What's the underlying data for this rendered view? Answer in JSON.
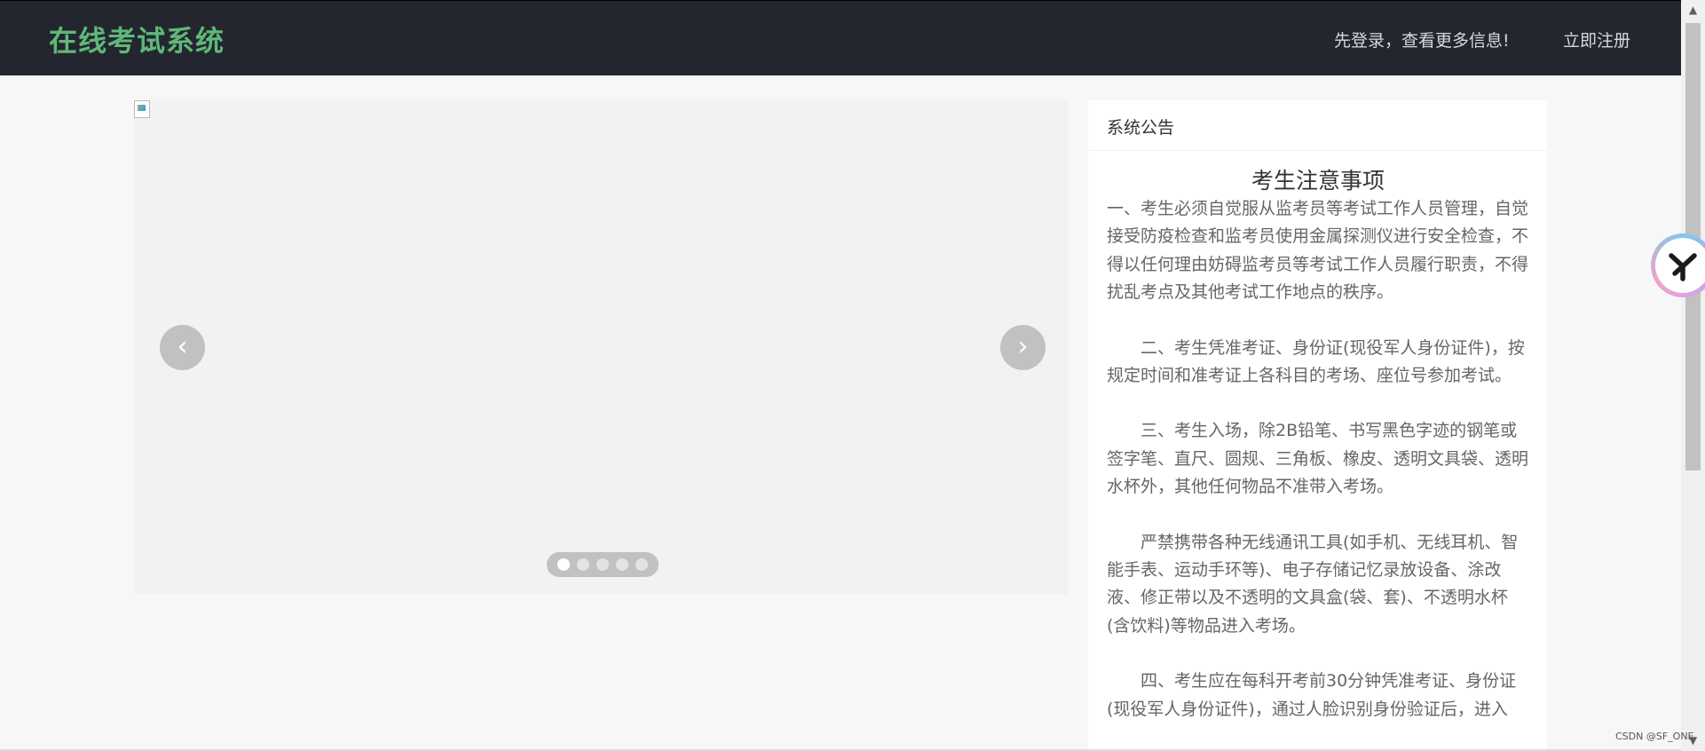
{
  "header": {
    "logo": "在线考试系统",
    "login_prompt": "先登录，查看更多信息!",
    "register": "立即注册"
  },
  "carousel": {
    "prev_glyph": "‹",
    "next_glyph": "›",
    "indicator_count": 5,
    "active_index": 0
  },
  "notice": {
    "header": "系统公告",
    "title": "考生注意事项",
    "paragraphs": [
      "一、考生必须自觉服从监考员等考试工作人员管理，自觉接受防疫检查和监考员使用金属探测仪进行安全检查，不得以任何理由妨碍监考员等考试工作人员履行职责，不得扰乱考点及其他考试工作地点的秩序。",
      "二、考生凭准考证、身份证(现役军人身份证件)，按规定时间和准考证上各科目的考场、座位号参加考试。",
      "三、考生入场，除2B铅笔、书写黑色字迹的钢笔或签字笔、直尺、圆规、三角板、橡皮、透明文具袋、透明水杯外，其他任何物品不准带入考场。",
      "严禁携带各种无线通讯工具(如手机、无线耳机、智能手表、运动手环等)、电子存储记忆录放设备、涂改液、修正带以及不透明的文具盒(袋、套)、不透明水杯(含饮料)等物品进入考场。",
      "四、考生应在每科开考前30分钟凭准考证、身份证(现役军人身份证件)，通过人脸识别身份验证后，进入"
    ]
  },
  "watermark": "CSDN @SF_ONE",
  "colors": {
    "header_bg": "#23262e",
    "logo": "#5fb878",
    "page_bg": "#f7f7f7"
  }
}
